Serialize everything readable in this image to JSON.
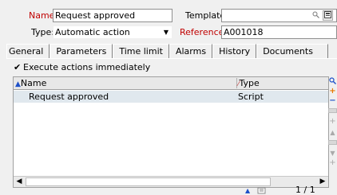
{
  "header": {
    "name_label": "Name:",
    "name_value": "Request approved",
    "template_label": "Template:",
    "template_value": "",
    "type_label": "Type:",
    "type_value": "Automatic action",
    "reference_label": "Reference:",
    "reference_value": "A001018"
  },
  "tabs": [
    {
      "label": "General"
    },
    {
      "label": "Parameters"
    },
    {
      "label": "Time limit"
    },
    {
      "label": "Alarms"
    },
    {
      "label": "History"
    },
    {
      "label": "Documents"
    }
  ],
  "active_tab": "Parameters",
  "options": {
    "execute_immediately_label": "Execute actions immediately",
    "execute_immediately_checked": true
  },
  "list": {
    "columns": [
      {
        "label": "Name",
        "sort": "ascending"
      },
      {
        "label": "Type",
        "sort": "none"
      }
    ],
    "rows": [
      {
        "name": "Request approved",
        "type": "Script"
      }
    ]
  },
  "status": {
    "page_count": "1 / 1"
  },
  "colors": {
    "required_label": "#c00000",
    "sort_arrow": "#1e50c8",
    "add_icon": "#e87800",
    "remove_icon": "#1e50c8"
  },
  "icons": {
    "template_zoom": "zoom-icon",
    "template_details": "details-icon",
    "type_dropdown": "chevron-down-icon",
    "add": "plus-icon",
    "remove": "minus-icon",
    "search": "magnifier-icon"
  }
}
